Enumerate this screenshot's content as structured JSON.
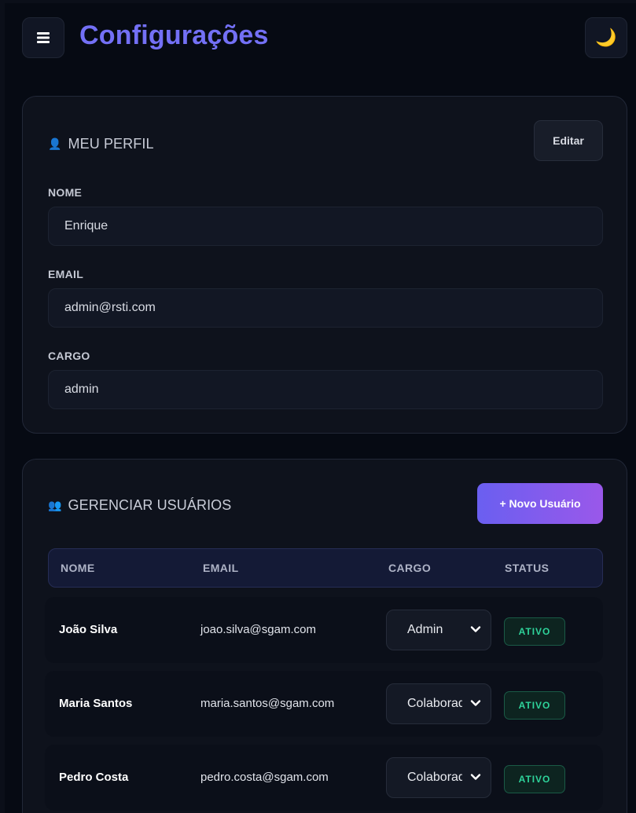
{
  "header": {
    "title": "Configurações",
    "menu_icon": "hamburger-icon",
    "theme_icon": "moon-icon",
    "theme_glyph": "🌙"
  },
  "profile": {
    "icon": "user-icon",
    "icon_glyph": "👤",
    "title": "MEU PERFIL",
    "edit_label": "Editar",
    "fields": [
      {
        "label": "NOME",
        "value": "Enrique"
      },
      {
        "label": "EMAIL",
        "value": "admin@rsti.com"
      },
      {
        "label": "CARGO",
        "value": "admin"
      }
    ]
  },
  "users": {
    "icon": "users-icon",
    "icon_glyph": "👥",
    "title": "GERENCIAR USUÁRIOS",
    "new_user_label": "+ Novo Usuário",
    "columns": [
      "NOME",
      "EMAIL",
      "CARGO",
      "STATUS"
    ],
    "rows": [
      {
        "name": "João Silva",
        "email": "joao.silva@sgam.com",
        "role": "Admin",
        "status": "ATIVO"
      },
      {
        "name": "Maria Santos",
        "email": "maria.santos@sgam.com",
        "role": "Colaborador",
        "status": "ATIVO"
      },
      {
        "name": "Pedro Costa",
        "email": "pedro.costa@sgam.com",
        "role": "Colaborador",
        "status": "ATIVO"
      }
    ]
  },
  "colors": {
    "accent": "#7370f5",
    "status_active": "#2ed39a",
    "background": "#060a13"
  }
}
